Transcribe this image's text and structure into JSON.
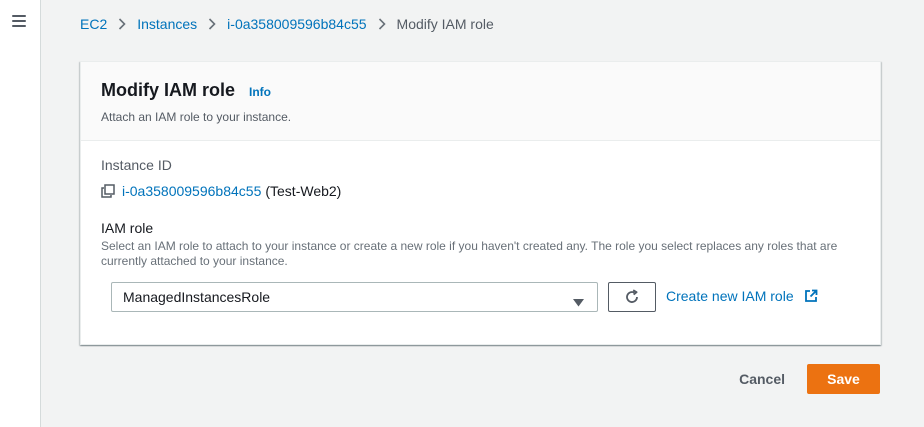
{
  "nav": {
    "menu_icon": "hamburger-menu-icon"
  },
  "breadcrumb": {
    "items": [
      "EC2",
      "Instances",
      "i-0a358009596b84c55"
    ],
    "current": "Modify IAM role",
    "separator_icon": "chevron-right-icon"
  },
  "panel": {
    "title": "Modify IAM role",
    "info_label": "Info",
    "description": "Attach an IAM role to your instance."
  },
  "instance": {
    "label": "Instance ID",
    "copy_icon": "copy-icon",
    "id": "i-0a358009596b84c55",
    "name": "(Test-Web2)"
  },
  "iam_role": {
    "label": "IAM role",
    "description": "Select an IAM role to attach to your instance or create a new role if you haven't created any. The role you select replaces any roles that are currently attached to your instance.",
    "selected": "ManagedInstancesRole",
    "caret_icon": "caret-down-icon",
    "refresh_icon": "refresh-icon",
    "create_label": "Create new IAM role",
    "external_icon": "external-link-icon"
  },
  "actions": {
    "cancel_label": "Cancel",
    "save_label": "Save"
  },
  "colors": {
    "link": "#0073bb",
    "primary": "#ec7211",
    "background": "#f2f3f3"
  }
}
